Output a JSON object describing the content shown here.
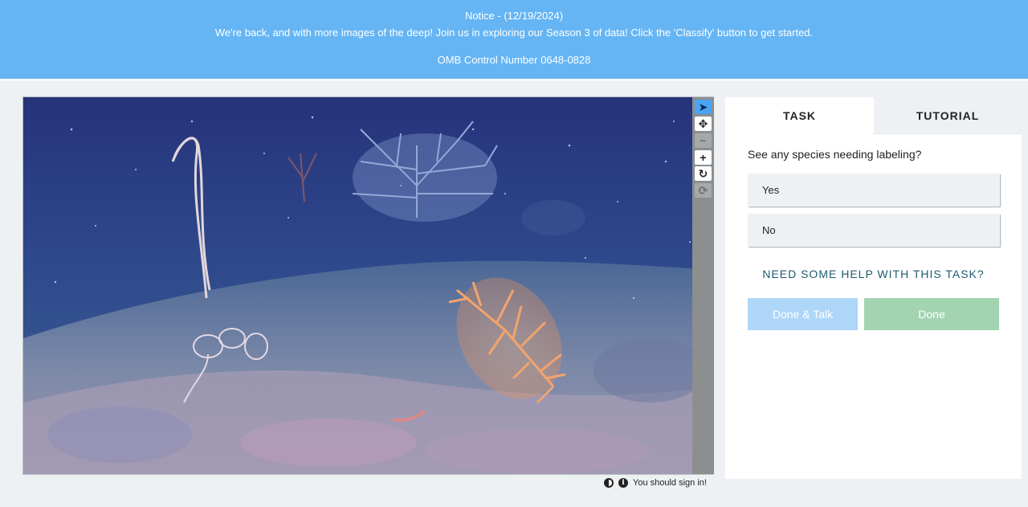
{
  "banner": {
    "notice": "Notice - (12/19/2024)",
    "message": "We're back, and with more images of the deep! Join us in exploring our Season 3 of data! Click the 'Classify' button to get started.",
    "omb": "OMB Control Number 0648-0828"
  },
  "toolbar": {
    "tools": [
      {
        "name": "pointer-tool",
        "icon": "pointer-icon",
        "glyph": "➤",
        "state": "active"
      },
      {
        "name": "move-tool",
        "icon": "move-icon",
        "glyph": "✥",
        "state": "normal"
      },
      {
        "name": "zoom-out-tool",
        "icon": "minus-icon",
        "glyph": "−",
        "state": "disabled"
      },
      {
        "name": "zoom-in-tool",
        "icon": "plus-icon",
        "glyph": "+",
        "state": "normal"
      },
      {
        "name": "rotate-tool",
        "icon": "rotate-icon",
        "glyph": "↻",
        "state": "normal"
      },
      {
        "name": "reset-tool",
        "icon": "reset-icon",
        "glyph": "⟳",
        "state": "disabled"
      }
    ]
  },
  "status": {
    "signin_text": "You should sign in!"
  },
  "panel": {
    "tabs": {
      "task": "TASK",
      "tutorial": "TUTORIAL"
    },
    "question": "See any species needing labeling?",
    "answers": [
      "Yes",
      "No"
    ],
    "help": "NEED SOME HELP WITH THIS TASK?",
    "done_talk": "Done & Talk",
    "done": "Done"
  },
  "colors": {
    "banner": "#65b5f4",
    "done_talk": "#aed6f8",
    "done": "#a3d4b2",
    "help_text": "#1e5b6e"
  }
}
